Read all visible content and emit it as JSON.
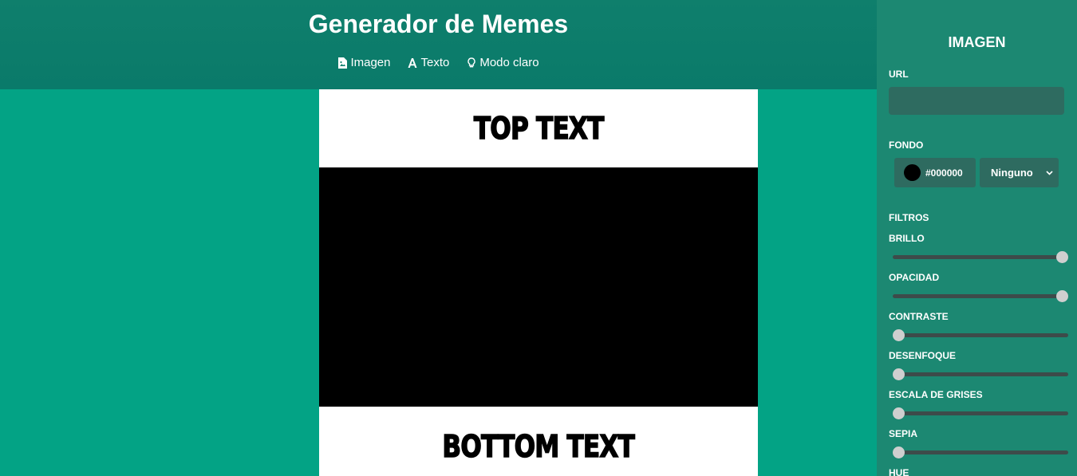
{
  "header": {
    "title": "Generador de Memes",
    "nav": [
      {
        "label": "Imagen",
        "icon": "image-file-icon"
      },
      {
        "label": "Texto",
        "icon": "text-icon"
      },
      {
        "label": "Modo claro",
        "icon": "lightbulb-icon"
      }
    ]
  },
  "meme": {
    "top_text": "TOP TEXT",
    "bottom_text": "BOTTOM TEXT",
    "background_color": "#000000"
  },
  "panel": {
    "title": "IMAGEN",
    "url_label": "URL",
    "url_value": "",
    "fondo_label": "FONDO",
    "color_value": "#000000",
    "blend_select": "Ninguno",
    "filters_label": "FILTROS",
    "filters": [
      {
        "label": "BRILLO",
        "level": 1
      },
      {
        "label": "OPACIDAD",
        "level": 1
      },
      {
        "label": "CONTRASTE",
        "level": 0
      },
      {
        "label": "DESENFOQUE",
        "level": 0
      },
      {
        "label": "ESCALA DE GRISES",
        "level": 0
      },
      {
        "label": "SEPIA",
        "level": 0
      },
      {
        "label": "HUE",
        "level": 0
      }
    ]
  },
  "colors": {
    "header_bg": "#0f7f6c",
    "main_bg": "#03a385",
    "panel_bg": "#1c8872",
    "input_bg": "#2e6b60"
  }
}
